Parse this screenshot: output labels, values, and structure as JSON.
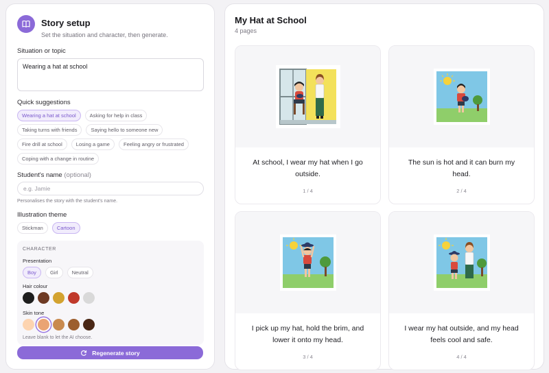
{
  "setup": {
    "title": "Story setup",
    "subtitle": "Set the situation and character, then generate.",
    "situation_label": "Situation or topic",
    "situation_value": "Wearing a hat at school",
    "quick_label": "Quick suggestions",
    "suggestions": [
      "Wearing a hat at school",
      "Asking for help in class",
      "Taking turns with friends",
      "Saying hello to someone new",
      "Fire drill at school",
      "Losing a game",
      "Feeling angry or frustrated",
      "Coping with a change in routine"
    ],
    "name_label": "Student's name",
    "name_optional": "(optional)",
    "name_placeholder": "e.g. Jamie",
    "name_hint": "Personalises the story with the student's name.",
    "theme_label": "Illustration theme",
    "themes": [
      "Stickman",
      "Cartoon"
    ],
    "selected_theme": "Cartoon",
    "character": {
      "title": "CHARACTER",
      "presentation_label": "Presentation",
      "presentations": [
        "Boy",
        "Girl",
        "Neutral"
      ],
      "selected_presentation": "Boy",
      "hair_label": "Hair colour",
      "hair_colors": [
        "#1e1e1e",
        "#6e3a24",
        "#d3a330",
        "#c0392b",
        "#d9d9d9"
      ],
      "skin_label": "Skin tone",
      "skin_tones": [
        "#fdd4b0",
        "#eaa474",
        "#c98a4e",
        "#9c5e2e",
        "#4a2716"
      ],
      "selected_skin_index": 1,
      "hint": "Leave blank to let the AI choose."
    },
    "generate_label": "Regenerate story",
    "accent": "#8b6ad8"
  },
  "story": {
    "title": "My Hat at School",
    "page_count": "4 pages",
    "pages": [
      {
        "text": "At school, I wear my hat when I go outside.",
        "num": "1 / 4"
      },
      {
        "text": "The sun is hot and it can burn my head.",
        "num": "2 / 4"
      },
      {
        "text": "I pick up my hat, hold the brim, and lower it onto my head.",
        "num": "3 / 4"
      },
      {
        "text": "I wear my hat outside, and my head feels cool and safe.",
        "num": "4 / 4"
      }
    ]
  }
}
